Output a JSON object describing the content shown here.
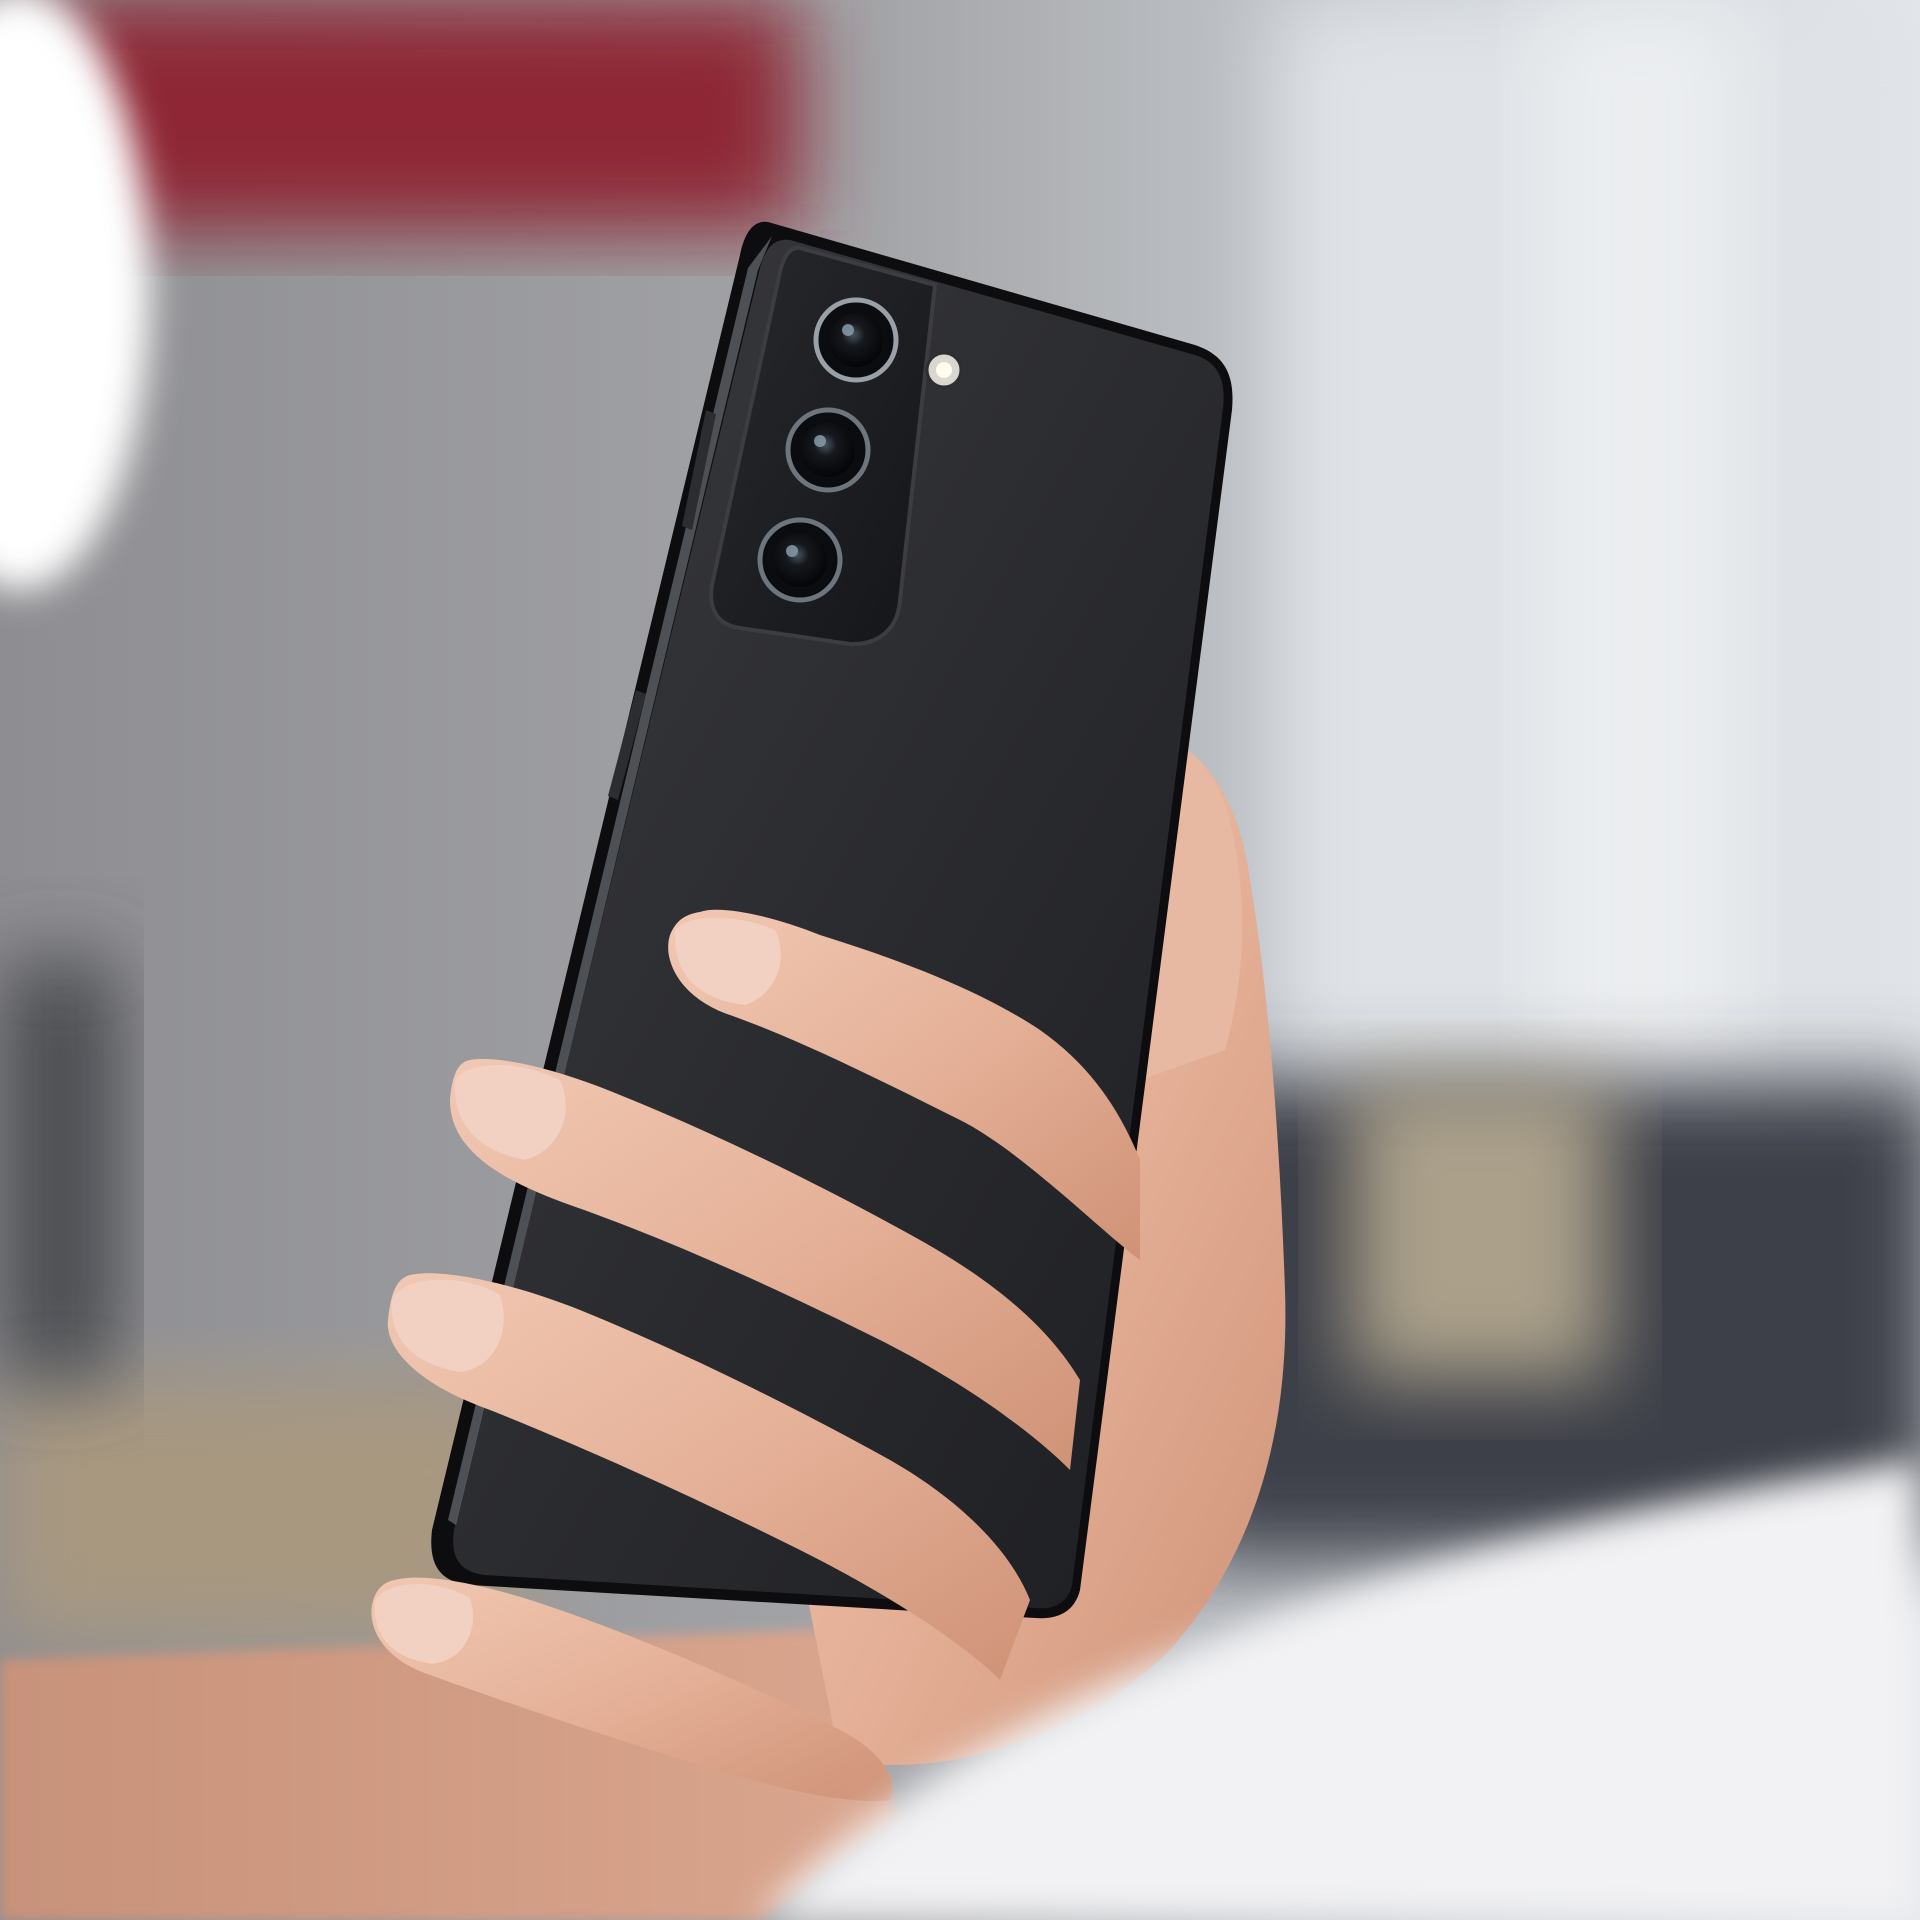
{
  "scene": {
    "subject": "hand-holding-smartphone",
    "phone": {
      "camera_count": 3,
      "has_flash": true
    },
    "colors": {
      "phone_body": "#2a2b2e",
      "phone_frame": "#0d0d0f",
      "camera_module": "#1c1d20",
      "lens_glass": "#0b0c10",
      "skin": "#e6b49c",
      "background_gray": "#9a9a9c",
      "background_red": "#8e2634",
      "background_white": "#f2f2f4"
    }
  }
}
